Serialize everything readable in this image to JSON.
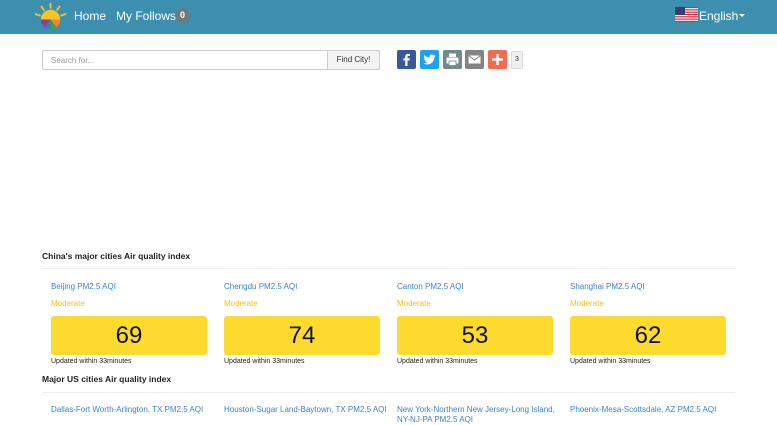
{
  "nav": {
    "home": "Home",
    "follows": "My Follows",
    "follows_count": "0",
    "language": "English"
  },
  "search": {
    "placeholder": "Search for...",
    "button": "Find City!"
  },
  "share": {
    "count": "3",
    "icons": [
      "facebook-icon",
      "twitter-icon",
      "print-icon",
      "email-icon",
      "addthis-plus-icon"
    ],
    "colors": {
      "facebook": "#3b5998",
      "twitter": "#1da1f2",
      "print": "#738a8d",
      "email": "#848484",
      "plus": "#f8694d"
    }
  },
  "china": {
    "title": "China's major cities Air quality index",
    "cities": [
      {
        "name": "Beijing PM2.5 AQI",
        "level": "Moderate",
        "aqi": "69",
        "updated": "Updated within 33minutes"
      },
      {
        "name": "Chengdu PM2.5 AQI",
        "level": "Moderate",
        "aqi": "74",
        "updated": "Updated within 33minutes"
      },
      {
        "name": "Canton PM2.5 AQI",
        "level": "Moderate",
        "aqi": "53",
        "updated": "Updated within 33minutes"
      },
      {
        "name": "Shanghai PM2.5 AQI",
        "level": "Moderate",
        "aqi": "62",
        "updated": "Updated within 33minutes"
      }
    ]
  },
  "us": {
    "title": "Major US cities Air quality index",
    "cities": [
      {
        "name": "Dallas-Fort Worth-Arlington, TX PM2.5 AQI"
      },
      {
        "name": "Houston-Sugar Land-Baytown, TX PM2.5 AQI"
      },
      {
        "name": "New York-Northern New Jersey-Long Island, NY-NJ-PA PM2.5 AQI"
      },
      {
        "name": "Phoenix-Mesa-Scottsdale, AZ PM2.5 AQI"
      }
    ]
  },
  "colors": {
    "navbar": "#3d8fb0",
    "moderate": "#fddb2e",
    "link": "#3b85c7"
  }
}
